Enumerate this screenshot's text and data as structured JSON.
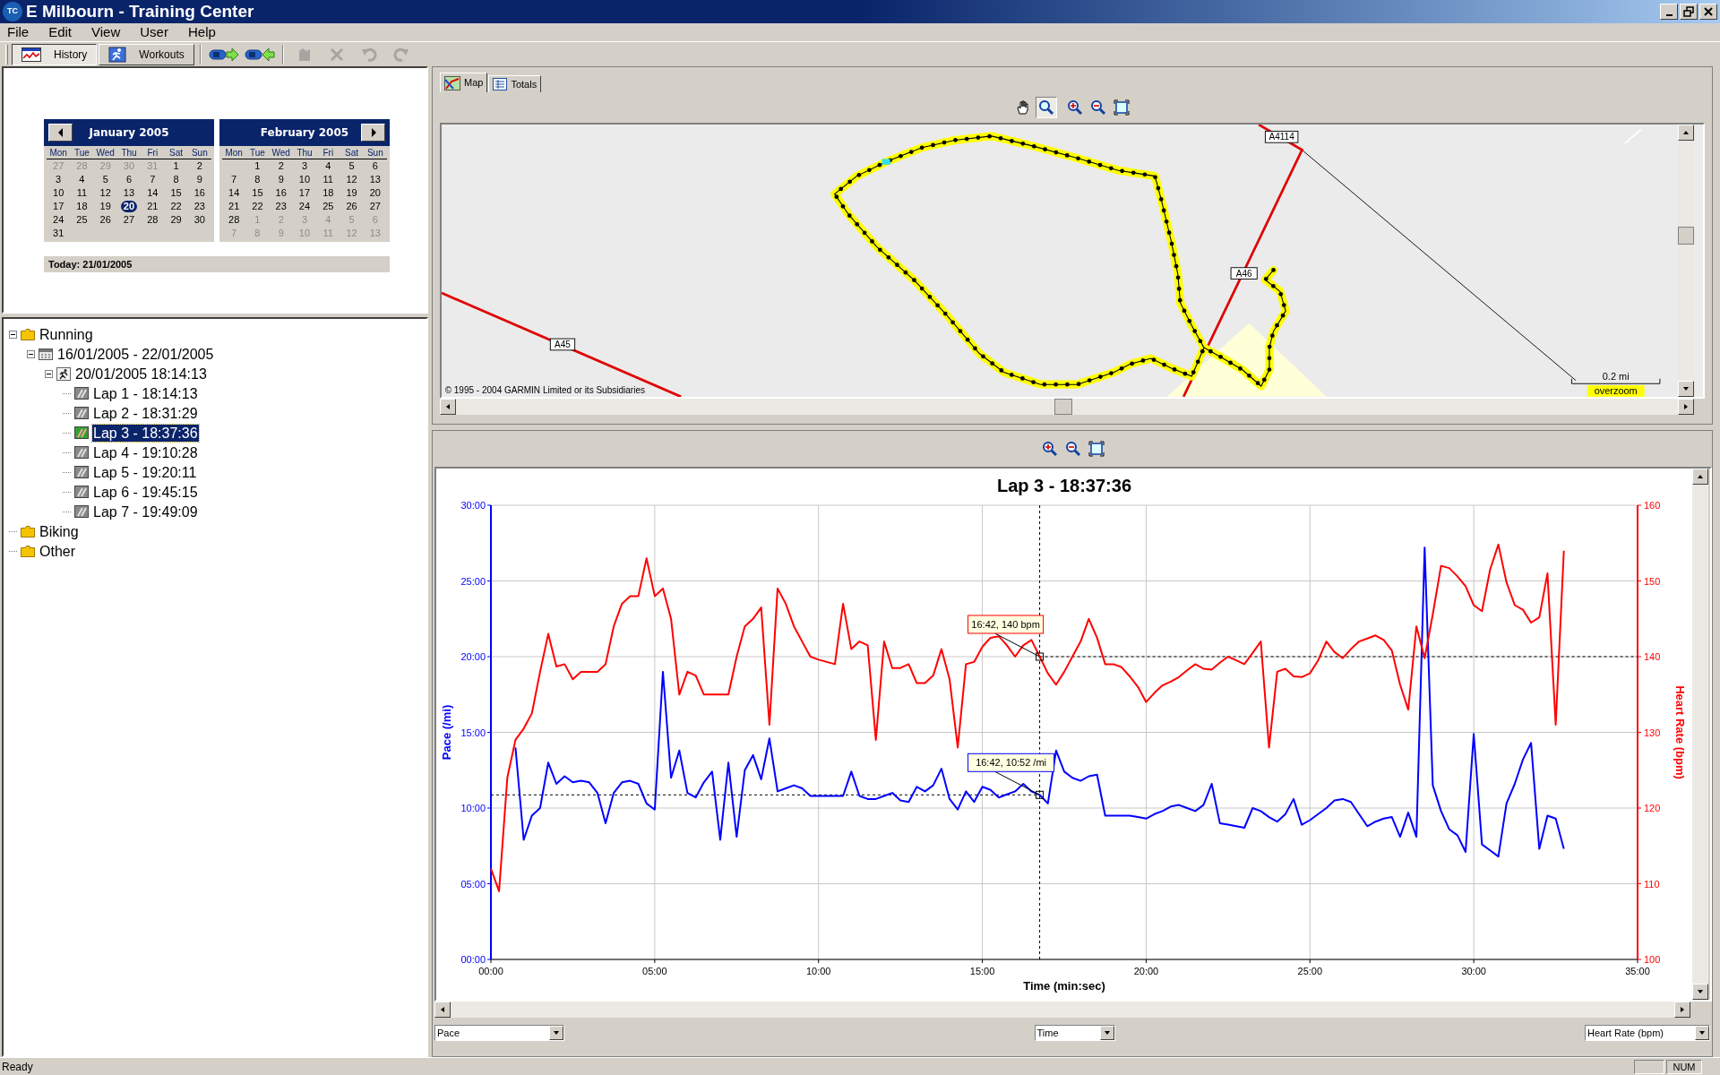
{
  "window": {
    "logo": "TC",
    "title": "E Milbourn - Training Center"
  },
  "menu": [
    "File",
    "Edit",
    "View",
    "User",
    "Help"
  ],
  "toolbar": {
    "views": [
      {
        "label": "History",
        "kind": "history",
        "selected": true
      },
      {
        "label": "Workouts",
        "kind": "workouts",
        "selected": false
      }
    ],
    "tools": [
      {
        "kind": "import",
        "disabled": false
      },
      {
        "kind": "export",
        "disabled": false
      },
      {
        "kind": "stamp",
        "disabled": true
      },
      {
        "kind": "delete",
        "disabled": true
      },
      {
        "kind": "undo",
        "disabled": true
      },
      {
        "kind": "redo",
        "disabled": true
      }
    ]
  },
  "calendar": {
    "months": [
      {
        "title": "January 2005",
        "kind": "prev",
        "weekdays": [
          "Mon",
          "Tue",
          "Wed",
          "Thu",
          "Fri",
          "Sat",
          "Sun"
        ],
        "weeks": [
          [
            {
              "d": "27",
              "muted": true,
              "selected": false
            },
            {
              "d": "28",
              "muted": true,
              "selected": false
            },
            {
              "d": "29",
              "muted": true,
              "selected": false
            },
            {
              "d": "30",
              "muted": true,
              "selected": false
            },
            {
              "d": "31",
              "muted": true,
              "selected": false
            },
            {
              "d": "1",
              "muted": false,
              "selected": false
            },
            {
              "d": "2",
              "muted": false,
              "selected": false
            }
          ],
          [
            {
              "d": "3",
              "muted": false,
              "selected": false
            },
            {
              "d": "4",
              "muted": false,
              "selected": false
            },
            {
              "d": "5",
              "muted": false,
              "selected": false
            },
            {
              "d": "6",
              "muted": false,
              "selected": false
            },
            {
              "d": "7",
              "muted": false,
              "selected": false
            },
            {
              "d": "8",
              "muted": false,
              "selected": false
            },
            {
              "d": "9",
              "muted": false,
              "selected": false
            }
          ],
          [
            {
              "d": "10",
              "muted": false,
              "selected": false
            },
            {
              "d": "11",
              "muted": false,
              "selected": false
            },
            {
              "d": "12",
              "muted": false,
              "selected": false
            },
            {
              "d": "13",
              "muted": false,
              "selected": false
            },
            {
              "d": "14",
              "muted": false,
              "selected": false
            },
            {
              "d": "15",
              "muted": false,
              "selected": false
            },
            {
              "d": "16",
              "muted": false,
              "selected": false
            }
          ],
          [
            {
              "d": "17",
              "muted": false,
              "selected": false
            },
            {
              "d": "18",
              "muted": false,
              "selected": false
            },
            {
              "d": "19",
              "muted": false,
              "selected": false
            },
            {
              "d": "20",
              "muted": false,
              "selected": true
            },
            {
              "d": "21",
              "muted": false,
              "selected": false
            },
            {
              "d": "22",
              "muted": false,
              "selected": false
            },
            {
              "d": "23",
              "muted": false,
              "selected": false
            }
          ],
          [
            {
              "d": "24",
              "muted": false,
              "selected": false
            },
            {
              "d": "25",
              "muted": false,
              "selected": false
            },
            {
              "d": "26",
              "muted": false,
              "selected": false
            },
            {
              "d": "27",
              "muted": false,
              "selected": false
            },
            {
              "d": "28",
              "muted": false,
              "selected": false
            },
            {
              "d": "29",
              "muted": false,
              "selected": false
            },
            {
              "d": "30",
              "muted": false,
              "selected": false
            }
          ],
          [
            {
              "d": "31",
              "muted": false,
              "selected": false
            }
          ]
        ]
      },
      {
        "title": "February 2005",
        "kind": "next",
        "weekdays": [
          "Mon",
          "Tue",
          "Wed",
          "Thu",
          "Fri",
          "Sat",
          "Sun"
        ],
        "weeks": [
          [
            {
              "d": "1",
              "muted": false,
              "selected": false
            },
            {
              "d": "2",
              "muted": false,
              "selected": false
            },
            {
              "d": "3",
              "muted": false,
              "selected": false
            },
            {
              "d": "4",
              "muted": false,
              "selected": false
            },
            {
              "d": "5",
              "muted": false,
              "selected": false
            },
            {
              "d": "6",
              "muted": false,
              "selected": false
            }
          ],
          [
            {
              "d": "7",
              "muted": false,
              "selected": false
            },
            {
              "d": "8",
              "muted": false,
              "selected": false
            },
            {
              "d": "9",
              "muted": false,
              "selected": false
            },
            {
              "d": "10",
              "muted": false,
              "selected": false
            },
            {
              "d": "11",
              "muted": false,
              "selected": false
            },
            {
              "d": "12",
              "muted": false,
              "selected": false
            },
            {
              "d": "13",
              "muted": false,
              "selected": false
            }
          ],
          [
            {
              "d": "14",
              "muted": false,
              "selected": false
            },
            {
              "d": "15",
              "muted": false,
              "selected": false
            },
            {
              "d": "16",
              "muted": false,
              "selected": false
            },
            {
              "d": "17",
              "muted": false,
              "selected": false
            },
            {
              "d": "18",
              "muted": false,
              "selected": false
            },
            {
              "d": "19",
              "muted": false,
              "selected": false
            },
            {
              "d": "20",
              "muted": false,
              "selected": false
            }
          ],
          [
            {
              "d": "21",
              "muted": false,
              "selected": false
            },
            {
              "d": "22",
              "muted": false,
              "selected": false
            },
            {
              "d": "23",
              "muted": false,
              "selected": false
            },
            {
              "d": "24",
              "muted": false,
              "selected": false
            },
            {
              "d": "25",
              "muted": false,
              "selected": false
            },
            {
              "d": "26",
              "muted": false,
              "selected": false
            },
            {
              "d": "27",
              "muted": false,
              "selected": false
            }
          ],
          [
            {
              "d": "28",
              "muted": false,
              "selected": false
            },
            {
              "d": "1",
              "muted": true,
              "selected": false
            },
            {
              "d": "2",
              "muted": true,
              "selected": false
            },
            {
              "d": "3",
              "muted": true,
              "selected": false
            },
            {
              "d": "4",
              "muted": true,
              "selected": false
            },
            {
              "d": "5",
              "muted": true,
              "selected": false
            },
            {
              "d": "6",
              "muted": true,
              "selected": false
            }
          ],
          [
            {
              "d": "7",
              "muted": true,
              "selected": false
            },
            {
              "d": "8",
              "muted": true,
              "selected": false
            },
            {
              "d": "9",
              "muted": true,
              "selected": false
            },
            {
              "d": "10",
              "muted": true,
              "selected": false
            },
            {
              "d": "11",
              "muted": true,
              "selected": false
            },
            {
              "d": "12",
              "muted": true,
              "selected": false
            },
            {
              "d": "13",
              "muted": true,
              "selected": false
            }
          ]
        ]
      }
    ],
    "today": "Today: 21/01/2005"
  },
  "tree": [
    {
      "label": "Running",
      "kind": "folder",
      "expanded": true,
      "selected": false,
      "children": [
        {
          "label": "16/01/2005 - 22/01/2005",
          "kind": "week",
          "expanded": true,
          "selected": false,
          "children": [
            {
              "label": "20/01/2005 18:14:13",
              "kind": "activity",
              "expanded": true,
              "selected": false,
              "children": [
                {
                  "label": "Lap 1 - 18:14:13",
                  "kind": "lap",
                  "selected": false
                },
                {
                  "label": "Lap 2 - 18:31:29",
                  "kind": "lap",
                  "selected": false
                },
                {
                  "label": "Lap 3 - 18:37:36",
                  "kind": "lap",
                  "selected": true
                },
                {
                  "label": "Lap 4 - 19:10:28",
                  "kind": "lap",
                  "selected": false
                },
                {
                  "label": "Lap 5 - 19:20:11",
                  "kind": "lap",
                  "selected": false
                },
                {
                  "label": "Lap 6 - 19:45:15",
                  "kind": "lap",
                  "selected": false
                },
                {
                  "label": "Lap 7 - 19:49:09",
                  "kind": "lap",
                  "selected": false
                }
              ]
            }
          ]
        }
      ]
    },
    {
      "label": "Biking",
      "kind": "folder",
      "selected": false
    },
    {
      "label": "Other",
      "kind": "folder",
      "selected": false
    }
  ],
  "map_panel": {
    "tabs": [
      {
        "label": "Map",
        "kind": "map",
        "selected": true
      },
      {
        "label": "Totals",
        "kind": "totals",
        "selected": false
      }
    ],
    "tools": [
      {
        "kind": "hand",
        "selected": false
      },
      {
        "kind": "zoom",
        "selected": true
      },
      {
        "kind": "zoom-in",
        "selected": false
      },
      {
        "kind": "zoom-out",
        "selected": false
      },
      {
        "kind": "fit",
        "selected": false
      }
    ],
    "road_labels": [
      {
        "text": "A4114",
        "kind": "a4114"
      },
      {
        "text": "A46",
        "kind": "a46"
      },
      {
        "text": "A45",
        "kind": "a45"
      }
    ],
    "copyright": "© 1995 - 2004 GARMIN Limited or its Subsidiaries",
    "scale": "0.2 mi",
    "overzoom": "overzoom"
  },
  "chart_panel": {
    "tools": [
      {
        "kind": "zoom-in"
      },
      {
        "kind": "zoom-out"
      },
      {
        "kind": "fit"
      }
    ],
    "chart_data": {
      "type": "line",
      "title": "Lap 3 - 18:37:36",
      "xlabel": "Time (min:sec)",
      "ylabel": "Pace (/mi)",
      "y2label": "Heart Rate (bpm)",
      "xlim": [
        0,
        35
      ],
      "ylim": [
        0,
        30
      ],
      "y2lim": [
        100,
        160
      ],
      "xticks": [
        {
          "value": 0,
          "label": "00:00"
        },
        {
          "value": 5,
          "label": "05:00"
        },
        {
          "value": 10,
          "label": "10:00"
        },
        {
          "value": 15,
          "label": "15:00"
        },
        {
          "value": 20,
          "label": "20:00"
        },
        {
          "value": 25,
          "label": "25:00"
        },
        {
          "value": 30,
          "label": "30:00"
        },
        {
          "value": 35,
          "label": "35:00"
        }
      ],
      "yticks": [
        {
          "value": 0,
          "label": "00:00"
        },
        {
          "value": 5,
          "label": "05:00"
        },
        {
          "value": 10,
          "label": "10:00"
        },
        {
          "value": 15,
          "label": "15:00"
        },
        {
          "value": 20,
          "label": "20:00"
        },
        {
          "value": 25,
          "label": "25:00"
        },
        {
          "value": 30,
          "label": "30:00"
        }
      ],
      "y2ticks": [
        100,
        110,
        120,
        130,
        140,
        150,
        160
      ],
      "x": [
        0,
        0.25,
        0.5,
        0.75,
        1,
        1.25,
        1.5,
        1.75,
        2,
        2.25,
        2.5,
        2.75,
        3,
        3.25,
        3.5,
        3.75,
        4,
        4.25,
        4.5,
        4.75,
        5,
        5.25,
        5.5,
        5.75,
        6,
        6.25,
        6.5,
        6.75,
        7,
        7.25,
        7.5,
        7.75,
        8,
        8.25,
        8.5,
        8.75,
        9,
        9.25,
        9.5,
        9.75,
        10,
        10.25,
        10.5,
        10.75,
        11,
        11.25,
        11.5,
        11.75,
        12,
        12.25,
        12.5,
        12.75,
        13,
        13.25,
        13.5,
        13.75,
        14,
        14.25,
        14.5,
        14.75,
        15,
        15.25,
        15.5,
        15.75,
        16,
        16.25,
        16.5,
        16.75,
        17,
        17.25,
        17.5,
        17.75,
        18,
        18.25,
        18.5,
        18.75,
        19,
        19.25,
        19.5,
        19.75,
        20,
        20.25,
        20.5,
        20.75,
        21,
        21.25,
        21.5,
        21.75,
        22,
        22.25,
        22.5,
        22.75,
        23,
        23.25,
        23.5,
        23.75,
        24,
        24.25,
        24.5,
        24.75,
        25,
        25.25,
        25.5,
        25.75,
        26,
        26.25,
        26.5,
        26.75,
        27,
        27.25,
        27.5,
        27.75,
        28,
        28.25,
        28.5,
        28.75,
        29,
        29.25,
        29.5,
        29.75,
        30,
        30.25,
        30.5,
        30.75,
        31,
        31.25,
        31.5,
        31.75,
        32,
        32.25,
        32.5,
        32.75
      ],
      "series": [
        {
          "color": "#0000ff",
          "values": [
            null,
            null,
            null,
            14.0,
            7.9,
            9.5,
            10.0,
            13.0,
            11.6,
            12.1,
            11.7,
            11.8,
            11.7,
            11.0,
            9.0,
            11.0,
            11.7,
            11.8,
            11.6,
            10.3,
            9.9,
            19.0,
            12.0,
            13.8,
            11.0,
            10.7,
            11.7,
            12.4,
            7.9,
            13.0,
            8.1,
            12.5,
            13.5,
            11.9,
            14.6,
            11.1,
            11.3,
            11.5,
            11.3,
            10.8,
            10.8,
            10.8,
            10.8,
            10.8,
            12.4,
            10.8,
            10.6,
            10.6,
            10.8,
            11.0,
            10.5,
            10.4,
            11.4,
            11.1,
            11.5,
            12.6,
            10.6,
            9.9,
            11.1,
            10.4,
            11.4,
            11.2,
            10.7,
            10.9,
            11.1,
            11.6,
            11.1,
            10.87,
            10.3,
            13.8,
            12.4,
            12.0,
            11.8,
            12.1,
            12.2,
            9.5,
            9.5,
            9.5,
            9.5,
            9.4,
            9.3,
            9.6,
            9.8,
            10.1,
            10.2,
            10.0,
            9.8,
            10.2,
            11.6,
            9.0,
            8.9,
            8.8,
            8.7,
            10.0,
            9.8,
            9.4,
            9.1,
            9.6,
            10.6,
            8.9,
            9.2,
            9.6,
            10.0,
            10.5,
            10.6,
            10.4,
            9.6,
            8.8,
            9.1,
            9.3,
            9.4,
            8.1,
            9.7,
            8.1,
            27.2,
            11.5,
            9.8,
            8.6,
            8.2,
            7.1,
            14.9,
            7.6,
            7.2,
            6.8,
            10.3,
            11.6,
            13.2,
            14.3,
            7.3,
            9.5,
            9.3,
            7.3
          ]
        },
        {
          "color": "#ff0000",
          "axis": "y2",
          "values": [
            112,
            109,
            124,
            129,
            130.5,
            132.5,
            138,
            143,
            138.7,
            139,
            137,
            138,
            138,
            138,
            139,
            144,
            147,
            148,
            148,
            153,
            148,
            149,
            145,
            135,
            138,
            137.5,
            135,
            135,
            135,
            135,
            140,
            144,
            145,
            146.5,
            131,
            149,
            147,
            144,
            142,
            140,
            139.6,
            139.3,
            139,
            147,
            141,
            142,
            141.5,
            129,
            142,
            138.5,
            138.5,
            139,
            136.5,
            136.5,
            137.5,
            141,
            137,
            128,
            139,
            139.3,
            141.3,
            142.5,
            142.7,
            141.5,
            140,
            141.5,
            142.2,
            140,
            137.8,
            136.3,
            138,
            140,
            142,
            145,
            142.5,
            139,
            139,
            138.6,
            137.4,
            136,
            134,
            135.2,
            136.2,
            136.7,
            137.3,
            138.2,
            139,
            138.4,
            138.3,
            139.2,
            140,
            139.5,
            139,
            140.5,
            142,
            128,
            138,
            138.4,
            137.4,
            137.3,
            137.8,
            139.5,
            142,
            140.6,
            139.8,
            141,
            142,
            142.4,
            142.8,
            142.2,
            140.8,
            136.3,
            133,
            144,
            139.8,
            145.6,
            152,
            151.7,
            150.6,
            149.3,
            146.8,
            146,
            151.5,
            154.8,
            149.8,
            146.8,
            146.2,
            144.5,
            145.2,
            151,
            131,
            154
          ]
        }
      ],
      "grid": true,
      "ref_lines": [
        {
          "axis": "x",
          "value": 16.75,
          "color": "#000000"
        },
        {
          "axis": "y2",
          "value": 140,
          "color": "#000000"
        },
        {
          "axis": "y",
          "value": 10.87,
          "color": "#000000"
        }
      ],
      "annotations": [
        "16:42, 140 bpm",
        "16:42, 10:52 /mi"
      ]
    },
    "selectors": [
      {
        "value": "Pace",
        "kind": "left"
      },
      {
        "value": "Time",
        "kind": "center"
      },
      {
        "value": "Heart Rate (bpm)",
        "kind": "right"
      }
    ]
  },
  "status_bar": {
    "text": "Ready",
    "indicators": [
      "NUM"
    ]
  }
}
